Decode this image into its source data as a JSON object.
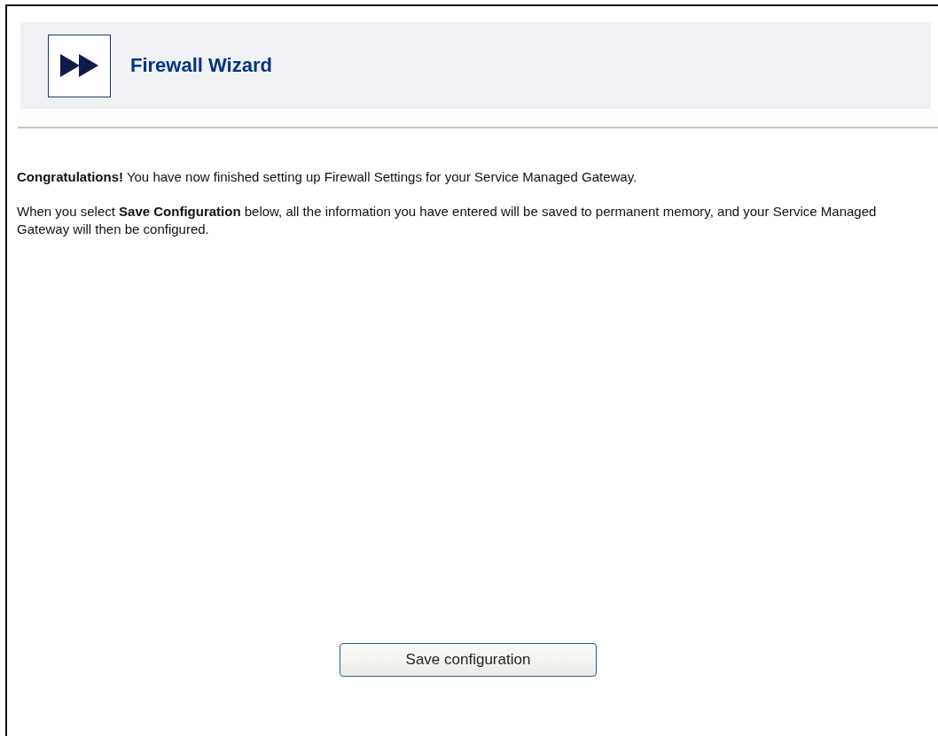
{
  "header": {
    "title": "Firewall Wizard"
  },
  "paragraphs": [
    "**Congratulations!** You have now finished setting up Firewall Settings for your Service Managed Gateway.",
    "When you select **Save Configuration** below, all the information you have entered will be saved to permanent memory, and your Service Managed Gateway will then be configured."
  ],
  "buttons": [
    "Save configuration"
  ]
}
